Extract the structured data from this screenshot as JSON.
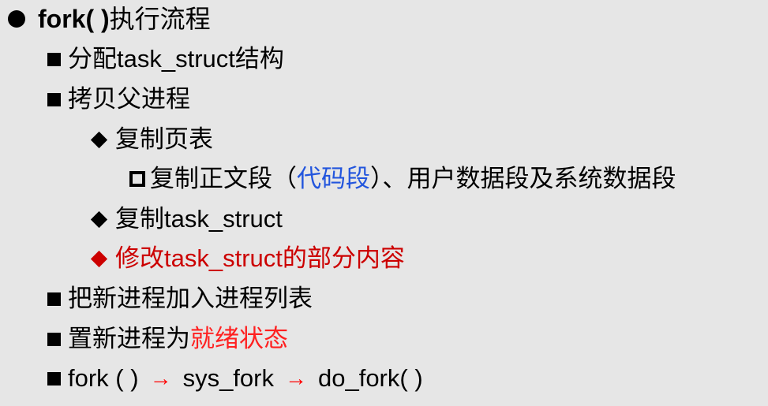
{
  "title": {
    "bold": "fork(  )",
    "rest": "执行流程"
  },
  "items": [
    {
      "text": "分配task_struct结构"
    },
    {
      "text": "拷贝父进程"
    },
    {
      "text": "复制页表"
    },
    {
      "part1": "复制正文段（",
      "part2": "代码段",
      "part3": "）、用户数据段及系统数据段"
    },
    {
      "text": "复制task_struct"
    },
    {
      "text": "修改task_struct的部分内容"
    },
    {
      "text": "把新进程加入进程列表"
    },
    {
      "part1": "置新进程为",
      "part2": "就绪状态"
    },
    {
      "part1": "fork ( )",
      "arrow1": "→",
      "part2": "sys_fork",
      "arrow2": "→",
      "part3": "do_fork( )"
    }
  ],
  "colors": {
    "background": "#e6e6e6",
    "accent_red": "#cc0000",
    "highlight_red": "#ff2020",
    "link_blue": "#2255dd"
  },
  "icons": {
    "level0": "filled-circle-bullet",
    "level1": "filled-square-bullet",
    "level2": "filled-diamond-bullet",
    "level3": "hollow-square-bullet"
  }
}
